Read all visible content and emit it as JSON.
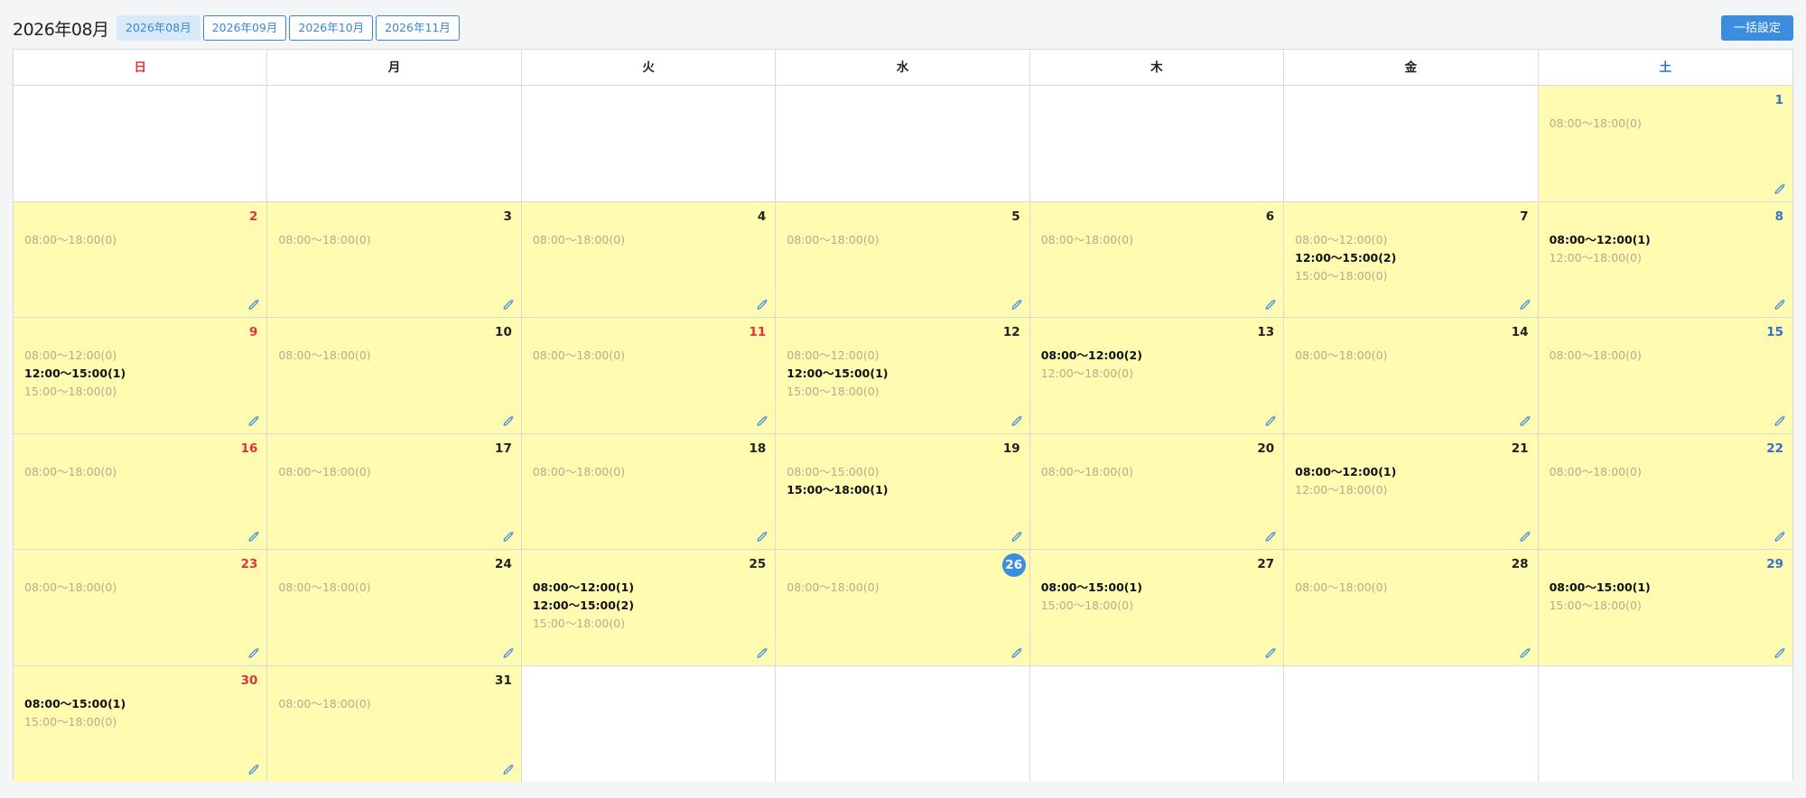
{
  "header": {
    "title": "2026年08月",
    "month_tabs": [
      {
        "label": "2026年08月",
        "active": true
      },
      {
        "label": "2026年09月",
        "active": false
      },
      {
        "label": "2026年10月",
        "active": false
      },
      {
        "label": "2026年11月",
        "active": false
      }
    ],
    "bulk_button_label": "一括設定"
  },
  "colors": {
    "accent": "#3b8de0",
    "day_background": "#fffbb0",
    "sunday_holiday": "#e0343d",
    "saturday": "#2f73c9"
  },
  "calendar": {
    "weekdays": [
      "日",
      "月",
      "火",
      "水",
      "木",
      "金",
      "土"
    ],
    "leading_empty": 6,
    "trailing_empty": 5,
    "today": 26,
    "holidays": [
      11
    ],
    "days": [
      {
        "day": 1,
        "slots": [
          {
            "time": "08:00〜18:00(0)",
            "booked": false
          }
        ]
      },
      {
        "day": 2,
        "slots": [
          {
            "time": "08:00〜18:00(0)",
            "booked": false
          }
        ]
      },
      {
        "day": 3,
        "slots": [
          {
            "time": "08:00〜18:00(0)",
            "booked": false
          }
        ]
      },
      {
        "day": 4,
        "slots": [
          {
            "time": "08:00〜18:00(0)",
            "booked": false
          }
        ]
      },
      {
        "day": 5,
        "slots": [
          {
            "time": "08:00〜18:00(0)",
            "booked": false
          }
        ]
      },
      {
        "day": 6,
        "slots": [
          {
            "time": "08:00〜18:00(0)",
            "booked": false
          }
        ]
      },
      {
        "day": 7,
        "slots": [
          {
            "time": "08:00〜12:00(0)",
            "booked": false
          },
          {
            "time": "12:00〜15:00(2)",
            "booked": true
          },
          {
            "time": "15:00〜18:00(0)",
            "booked": false
          }
        ]
      },
      {
        "day": 8,
        "slots": [
          {
            "time": "08:00〜12:00(1)",
            "booked": true
          },
          {
            "time": "12:00〜18:00(0)",
            "booked": false
          }
        ]
      },
      {
        "day": 9,
        "slots": [
          {
            "time": "08:00〜12:00(0)",
            "booked": false
          },
          {
            "time": "12:00〜15:00(1)",
            "booked": true
          },
          {
            "time": "15:00〜18:00(0)",
            "booked": false
          }
        ]
      },
      {
        "day": 10,
        "slots": [
          {
            "time": "08:00〜18:00(0)",
            "booked": false
          }
        ]
      },
      {
        "day": 11,
        "slots": [
          {
            "time": "08:00〜18:00(0)",
            "booked": false
          }
        ]
      },
      {
        "day": 12,
        "slots": [
          {
            "time": "08:00〜12:00(0)",
            "booked": false
          },
          {
            "time": "12:00〜15:00(1)",
            "booked": true
          },
          {
            "time": "15:00〜18:00(0)",
            "booked": false
          }
        ]
      },
      {
        "day": 13,
        "slots": [
          {
            "time": "08:00〜12:00(2)",
            "booked": true
          },
          {
            "time": "12:00〜18:00(0)",
            "booked": false
          }
        ]
      },
      {
        "day": 14,
        "slots": [
          {
            "time": "08:00〜18:00(0)",
            "booked": false
          }
        ]
      },
      {
        "day": 15,
        "slots": [
          {
            "time": "08:00〜18:00(0)",
            "booked": false
          }
        ]
      },
      {
        "day": 16,
        "slots": [
          {
            "time": "08:00〜18:00(0)",
            "booked": false
          }
        ]
      },
      {
        "day": 17,
        "slots": [
          {
            "time": "08:00〜18:00(0)",
            "booked": false
          }
        ]
      },
      {
        "day": 18,
        "slots": [
          {
            "time": "08:00〜18:00(0)",
            "booked": false
          }
        ]
      },
      {
        "day": 19,
        "slots": [
          {
            "time": "08:00〜15:00(0)",
            "booked": false
          },
          {
            "time": "15:00〜18:00(1)",
            "booked": true
          }
        ]
      },
      {
        "day": 20,
        "slots": [
          {
            "time": "08:00〜18:00(0)",
            "booked": false
          }
        ]
      },
      {
        "day": 21,
        "slots": [
          {
            "time": "08:00〜12:00(1)",
            "booked": true
          },
          {
            "time": "12:00〜18:00(0)",
            "booked": false
          }
        ]
      },
      {
        "day": 22,
        "slots": [
          {
            "time": "08:00〜18:00(0)",
            "booked": false
          }
        ]
      },
      {
        "day": 23,
        "slots": [
          {
            "time": "08:00〜18:00(0)",
            "booked": false
          }
        ]
      },
      {
        "day": 24,
        "slots": [
          {
            "time": "08:00〜18:00(0)",
            "booked": false
          }
        ]
      },
      {
        "day": 25,
        "slots": [
          {
            "time": "08:00〜12:00(1)",
            "booked": true
          },
          {
            "time": "12:00〜15:00(2)",
            "booked": true
          },
          {
            "time": "15:00〜18:00(0)",
            "booked": false
          }
        ]
      },
      {
        "day": 26,
        "slots": [
          {
            "time": "08:00〜18:00(0)",
            "booked": false
          }
        ]
      },
      {
        "day": 27,
        "slots": [
          {
            "time": "08:00〜15:00(1)",
            "booked": true
          },
          {
            "time": "15:00〜18:00(0)",
            "booked": false
          }
        ]
      },
      {
        "day": 28,
        "slots": [
          {
            "time": "08:00〜18:00(0)",
            "booked": false
          }
        ]
      },
      {
        "day": 29,
        "slots": [
          {
            "time": "08:00〜15:00(1)",
            "booked": true
          },
          {
            "time": "15:00〜18:00(0)",
            "booked": false
          }
        ]
      },
      {
        "day": 30,
        "slots": [
          {
            "time": "08:00〜15:00(1)",
            "booked": true
          },
          {
            "time": "15:00〜18:00(0)",
            "booked": false
          }
        ]
      },
      {
        "day": 31,
        "slots": [
          {
            "time": "08:00〜18:00(0)",
            "booked": false
          }
        ]
      }
    ],
    "edit_icon": "pencil-icon"
  }
}
